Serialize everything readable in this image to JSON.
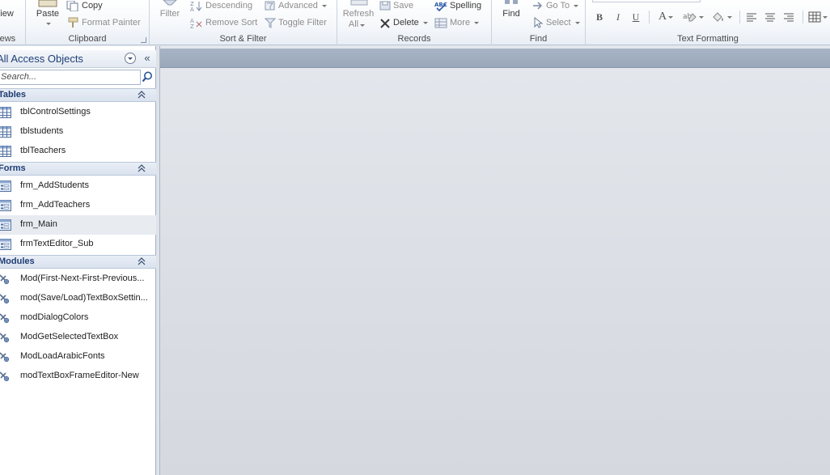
{
  "ribbon": {
    "views": {
      "label": "View",
      "group_label": "Views"
    },
    "clipboard": {
      "paste_label": "Paste",
      "copy_label": "Copy",
      "format_painter_label": "Format Painter",
      "group_label": "Clipboard"
    },
    "sort_filter": {
      "filter_label": "Filter",
      "descending_label": "Descending",
      "remove_sort_label": "Remove Sort",
      "advanced_label": "Advanced",
      "toggle_filter_label": "Toggle Filter",
      "group_label": "Sort & Filter"
    },
    "records": {
      "refresh_label": "Refresh",
      "refresh_all_label": "All",
      "save_label": "Save",
      "delete_label": "Delete",
      "spelling_label": "Spelling",
      "more_label": "More",
      "group_label": "Records"
    },
    "find": {
      "find_label": "Find",
      "goto_label": "Go To",
      "select_label": "Select",
      "group_label": "Find"
    },
    "text_formatting": {
      "bold_label": "B",
      "italic_label": "I",
      "underline_label": "U",
      "font_color_label": "A",
      "group_label": "Text Formatting"
    }
  },
  "nav": {
    "title": "All Access Objects",
    "search_placeholder": "Search...",
    "sections": [
      {
        "title": "Tables",
        "items": [
          "tblControlSettings",
          "tblstudents",
          "tblTeachers"
        ]
      },
      {
        "title": "Forms",
        "items": [
          "frm_AddStudents",
          "frm_AddTeachers",
          "frm_Main",
          "frmTextEditor_Sub"
        ]
      },
      {
        "title": "Modules",
        "items": [
          "Mod(First-Next-First-Previous...",
          "mod(Save/Load)TextBoxSettin...",
          "modDialogColors",
          "ModGetSelectedTextBox",
          "ModLoadArabicFonts",
          "modTextBoxFrameEditor-New"
        ]
      }
    ],
    "selected_item": "frm_Main"
  },
  "colors": {
    "nav_header_text": "#1f3f75",
    "workspace_bg": "#dfe3e8",
    "tab_bar": "#a3b0c2"
  }
}
